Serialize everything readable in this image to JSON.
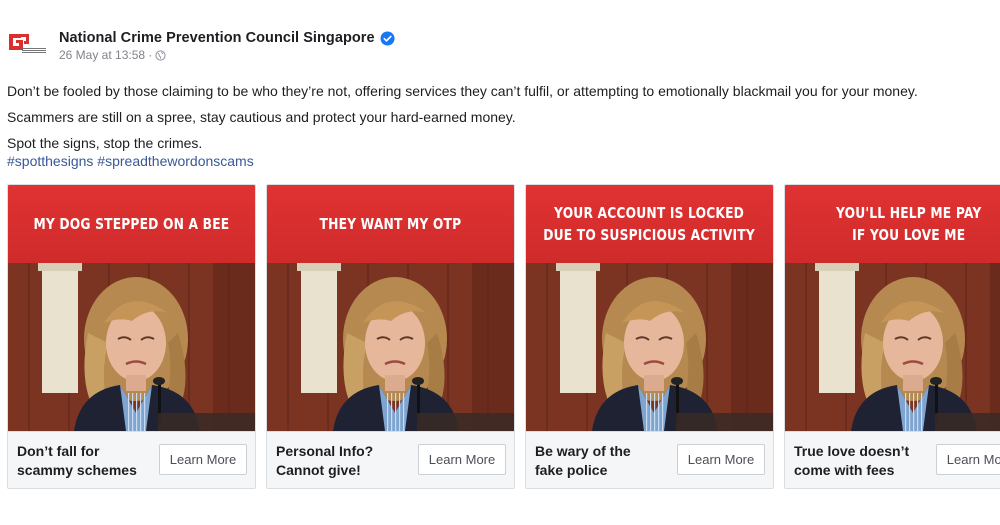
{
  "post": {
    "page_name": "National Crime Prevention Council Singapore",
    "timestamp": "26 May at 13:58 ·",
    "lines": [
      "Don’t be fooled by those claiming to be who they’re not, offering services they can’t fulfil, or attempting to emotionally blackmail you for your money.",
      "Scammers are still on a spree, stay cautious and protect your hard-earned money.",
      "Spot the signs, stop the crimes."
    ],
    "hashtags": [
      "#spotthesigns",
      "#spreadthewordonscams"
    ]
  },
  "icons": {
    "logo": "ncpc-logo-icon",
    "verified": "verified-badge-icon",
    "privacy": "globe-icon"
  },
  "colors": {
    "banner_red": "#d92f2f",
    "verified_blue": "#1877f2",
    "hashtag_blue": "#385898"
  },
  "cards": [
    {
      "banner_lines": [
        "MY DOG STEPPED ON A BEE"
      ],
      "title_lines": [
        "Don’t fall for",
        "scammy schemes"
      ],
      "cta": "Learn More"
    },
    {
      "banner_lines": [
        "THEY WANT MY OTP"
      ],
      "title_lines": [
        "Personal Info?",
        "Cannot give!"
      ],
      "cta": "Learn More"
    },
    {
      "banner_lines": [
        "YOUR ACCOUNT IS LOCKED",
        "DUE TO SUSPICIOUS ACTIVITY"
      ],
      "title_lines": [
        "Be wary of the",
        "fake police"
      ],
      "cta": "Learn More"
    },
    {
      "banner_lines": [
        "YOU'LL HELP ME PAY",
        "IF YOU LOVE ME"
      ],
      "title_lines": [
        "True love doesn’t",
        "come with fees"
      ],
      "cta": "Learn More"
    }
  ]
}
